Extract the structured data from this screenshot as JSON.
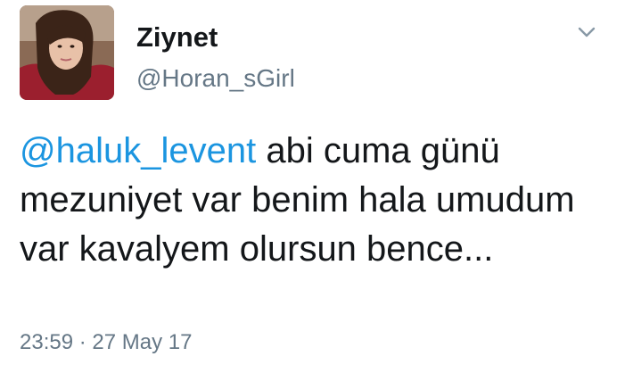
{
  "user": {
    "display_name": "Ziynet",
    "handle": "@Horan_sGirl"
  },
  "tweet": {
    "mention": "@haluk_levent",
    "text": " abi cuma günü mezuniyet var benim hala umudum var kavalyem olursun bence...",
    "time": "23:59",
    "separator": " · ",
    "date": "27 May 17"
  },
  "icons": {
    "avatar": "profile-photo",
    "menu": "chevron-down-icon"
  },
  "colors": {
    "text": "#14171a",
    "secondary": "#657786",
    "link": "#1b95e0"
  }
}
